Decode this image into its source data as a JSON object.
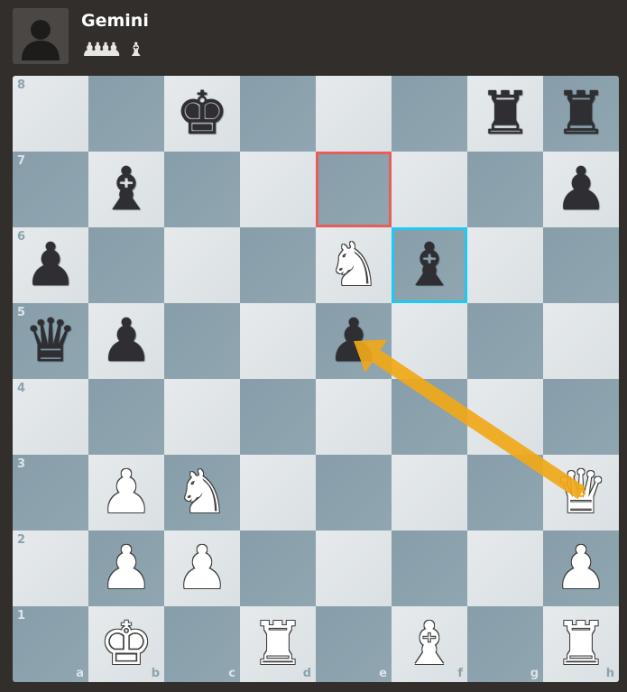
{
  "player": {
    "name": "Gemini",
    "avatar_icon": "user-silhouette-icon",
    "captured": {
      "pawns": [
        "♟",
        "♟",
        "♟",
        "♟"
      ],
      "bishop": "♝"
    }
  },
  "board": {
    "files": [
      "a",
      "b",
      "c",
      "d",
      "e",
      "f",
      "g",
      "h"
    ],
    "ranks": [
      "8",
      "7",
      "6",
      "5",
      "4",
      "3",
      "2",
      "1"
    ],
    "colors": {
      "light": "#dee3e6",
      "dark": "#8ca2ad",
      "arrow": "#f0a818",
      "highlight_red": "#e85c5c",
      "highlight_blue": "#1ec9f2"
    },
    "pieces": [
      {
        "square": "c8",
        "glyph": "♚",
        "color": "black",
        "type": "king"
      },
      {
        "square": "g8",
        "glyph": "♜",
        "color": "black",
        "type": "rook"
      },
      {
        "square": "h8",
        "glyph": "♜",
        "color": "black",
        "type": "rook"
      },
      {
        "square": "b7",
        "glyph": "♝",
        "color": "black",
        "type": "bishop"
      },
      {
        "square": "h7",
        "glyph": "♟",
        "color": "black",
        "type": "pawn"
      },
      {
        "square": "a6",
        "glyph": "♟",
        "color": "black",
        "type": "pawn"
      },
      {
        "square": "e6",
        "glyph": "♞",
        "color": "white",
        "type": "knight"
      },
      {
        "square": "f6",
        "glyph": "♝",
        "color": "black",
        "type": "bishop"
      },
      {
        "square": "a5",
        "glyph": "♛",
        "color": "black",
        "type": "queen"
      },
      {
        "square": "b5",
        "glyph": "♟",
        "color": "black",
        "type": "pawn"
      },
      {
        "square": "e5",
        "glyph": "♟",
        "color": "black",
        "type": "pawn"
      },
      {
        "square": "b3",
        "glyph": "♟",
        "color": "white",
        "type": "pawn"
      },
      {
        "square": "c3",
        "glyph": "♞",
        "color": "white",
        "type": "knight"
      },
      {
        "square": "h3",
        "glyph": "♛",
        "color": "white",
        "type": "queen"
      },
      {
        "square": "b2",
        "glyph": "♟",
        "color": "white",
        "type": "pawn"
      },
      {
        "square": "c2",
        "glyph": "♟",
        "color": "white",
        "type": "pawn"
      },
      {
        "square": "h2",
        "glyph": "♟",
        "color": "white",
        "type": "pawn"
      },
      {
        "square": "b1",
        "glyph": "♚",
        "color": "white",
        "type": "king"
      },
      {
        "square": "d1",
        "glyph": "♜",
        "color": "white",
        "type": "rook"
      },
      {
        "square": "f1",
        "glyph": "♝",
        "color": "white",
        "type": "bishop"
      },
      {
        "square": "h1",
        "glyph": "♜",
        "color": "white",
        "type": "rook"
      }
    ],
    "highlights": [
      {
        "square": "e7",
        "style": "hl-red"
      },
      {
        "square": "f6",
        "style": "hl-blue"
      }
    ],
    "arrow": {
      "from": "h3",
      "to": "e5"
    }
  }
}
